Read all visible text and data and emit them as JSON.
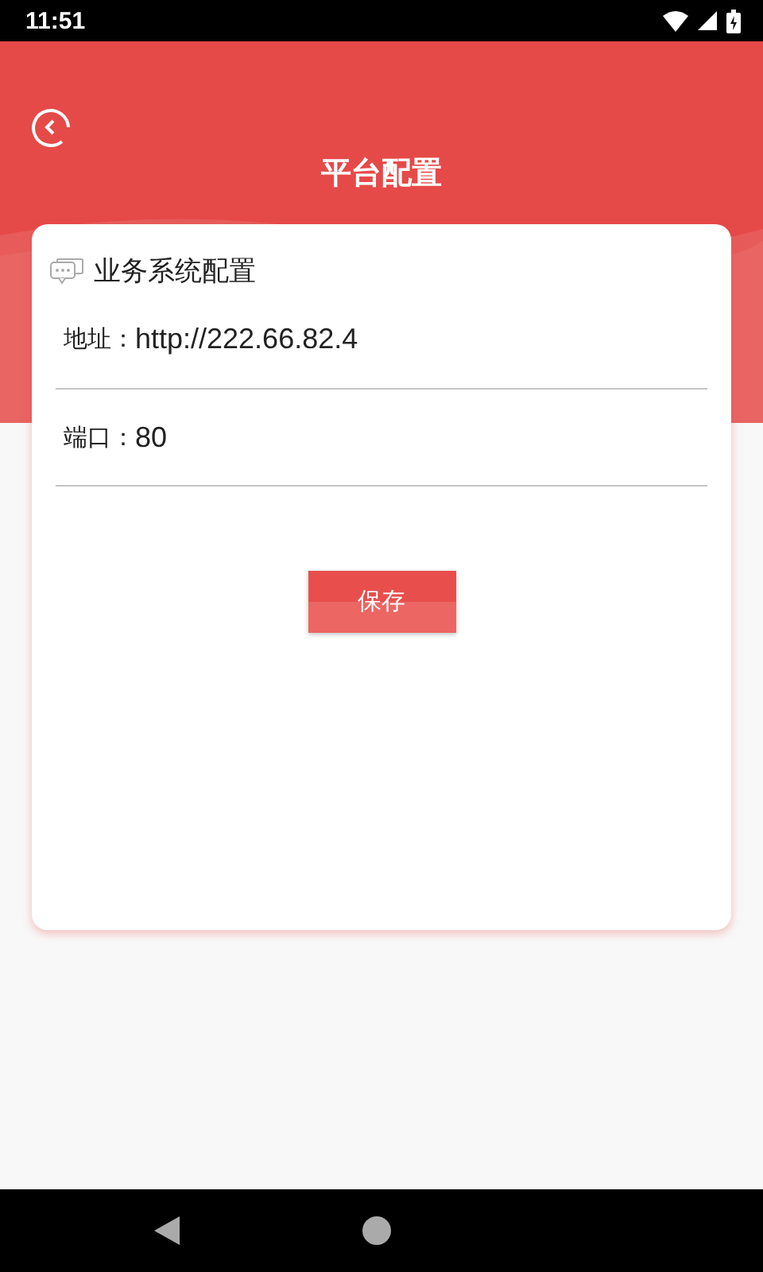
{
  "status_bar": {
    "time": "11:51"
  },
  "header": {
    "title": "平台配置"
  },
  "card": {
    "title": "业务系统配置",
    "fields": [
      {
        "label": "地址：",
        "value": "http://222.66.82.4"
      },
      {
        "label": "端口：",
        "value": "80"
      }
    ],
    "save_button": "保存"
  }
}
